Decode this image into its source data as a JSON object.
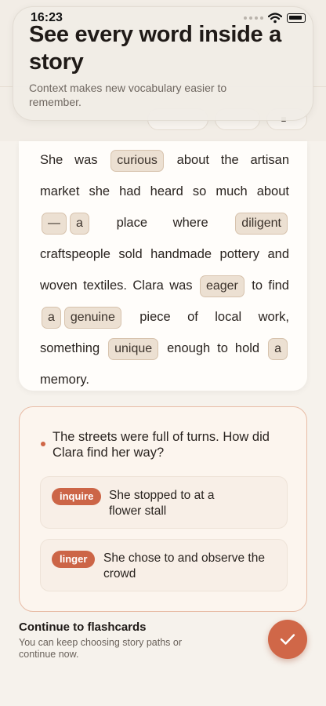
{
  "status_bar": {
    "time": "16:23"
  },
  "header": {
    "title": "See every word inside a story",
    "subtitle": "Context makes new vocabulary easier to remember."
  },
  "story": {
    "segments": [
      {
        "t": "text",
        "v": "She was "
      },
      {
        "t": "chip",
        "v": "curious"
      },
      {
        "t": "text",
        "v": " about the artisan market she had heard so much about "
      },
      {
        "t": "chip",
        "v": "—"
      },
      {
        "t": "chip",
        "v": "a"
      },
      {
        "t": "text",
        "v": " place where "
      },
      {
        "t": "chip",
        "v": "diligent"
      },
      {
        "t": "text",
        "v": " craftspeople sold handmade pottery and woven textiles. Clara was "
      },
      {
        "t": "chip",
        "v": "eager"
      },
      {
        "t": "text",
        "v": " to find "
      },
      {
        "t": "chip",
        "v": "a"
      },
      {
        "t": "chip",
        "v": "genuine"
      },
      {
        "t": "text",
        "v": " piece of local work, something "
      },
      {
        "t": "chip",
        "v": "unique"
      },
      {
        "t": "text",
        "v": " enough to hold "
      },
      {
        "t": "chip",
        "v": "a"
      },
      {
        "t": "text",
        "v": " memory."
      }
    ]
  },
  "question": {
    "text": "The streets were full of turns. How did Clara find her way?",
    "options": [
      {
        "tag": "inquire",
        "text": "She stopped to  at a flower stall"
      },
      {
        "tag": "linger",
        "text": "She chose to  and observe the crowd"
      }
    ]
  },
  "footer": {
    "title": "Continue to flashcards",
    "subtitle": "You can keep choosing story paths or continue now.",
    "fab_icon": "checkmark-icon"
  },
  "colors": {
    "accent": "#cf6646",
    "chip_bg": "#ece0d2",
    "background": "#f6f2ec"
  }
}
